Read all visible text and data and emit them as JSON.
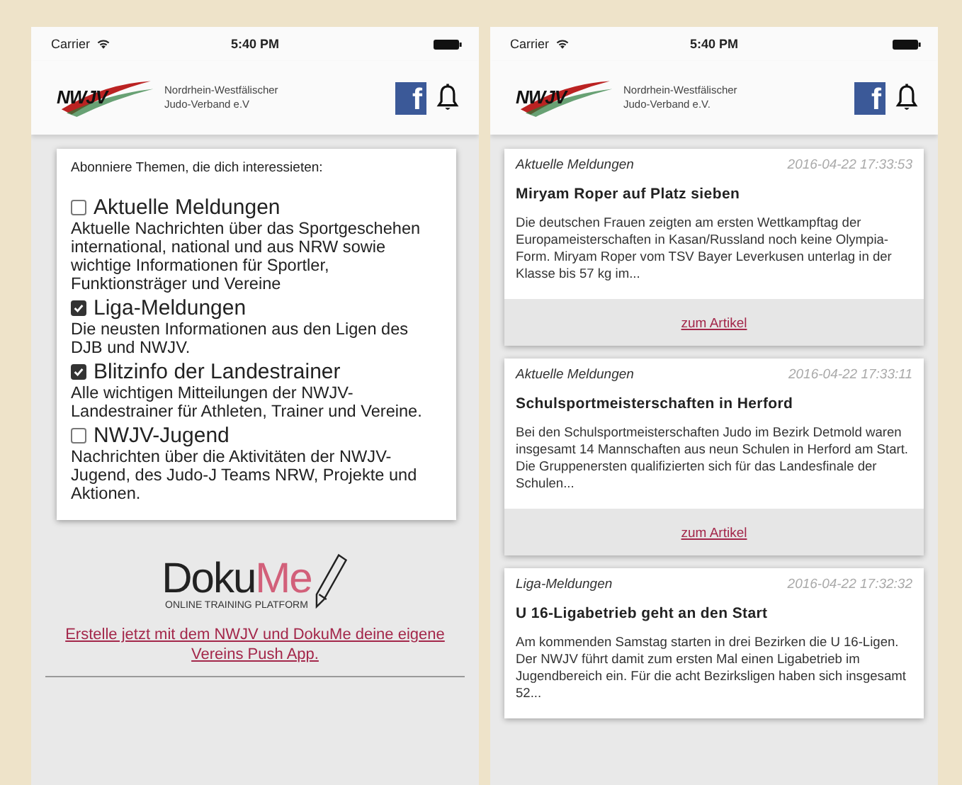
{
  "screens": [
    {
      "status_bar": {
        "carrier": "Carrier",
        "time": "5:40 PM"
      },
      "header": {
        "logo": "NWJV",
        "org_line1": "Nordrhein-Westfälischer",
        "org_line2": "Judo-Verband e.V",
        "facebook": "f"
      },
      "kind": "topics",
      "intro": "Abonniere Themen, die dich interessieten:",
      "topics": [
        {
          "title": "Aktuelle Meldungen",
          "checked": false,
          "description": "Aktuelle Nachrichten über das Sportgeschehen international, national und aus NRW sowie wichtige Informationen für Sportler, Funktionsträger und Vereine"
        },
        {
          "title": "Liga-Meldungen",
          "checked": true,
          "description": "Die neusten Informationen aus den Ligen des DJB und NWJV."
        },
        {
          "title": "Blitzinfo der Landestrainer",
          "checked": true,
          "description": "Alle wichtigen Mitteilungen der NWJV-Landestrainer für Athleten, Trainer und Vereine."
        },
        {
          "title": "NWJV-Jugend",
          "checked": false,
          "description": "Nachrichten über die Aktivitäten der NWJV-Jugend, des Judo-J Teams NRW, Projekte und Aktionen."
        }
      ],
      "promo": {
        "logo_part1": "Doku",
        "logo_part2": "Me",
        "tagline": "ONLINE TRAINING PLATFORM",
        "link": "Erstelle jetzt mit dem NWJV und DokuMe deine eigene Vereins Push App."
      }
    },
    {
      "status_bar": {
        "carrier": "Carrier",
        "time": "5:40 PM"
      },
      "header": {
        "logo": "NWJV",
        "org_line1": "Nordrhein-Westfälischer",
        "org_line2": "Judo-Verband e.V.",
        "facebook": "f"
      },
      "kind": "news",
      "articles": [
        {
          "category": "Aktuelle Meldungen",
          "timestamp": "2016-04-22 17:33:53",
          "title": "Miryam Roper auf Platz sieben",
          "teaser": "Die deutschen Frauen zeigten am ersten Wettkampftag der Europameisterschaften in Kasan/Russland noch keine Olympia-Form. Miryam Roper vom TSV Bayer Leverkusen unterlag in der Klasse bis 57 kg im...",
          "link": "zum Artikel"
        },
        {
          "category": "Aktuelle Meldungen",
          "timestamp": "2016-04-22 17:33:11",
          "title": "Schulsportmeisterschaften in Herford",
          "teaser": "Bei den Schulsportmeisterschaften Judo im Bezirk Detmold waren insgesamt 14 Mannschaften aus neun Schulen in Herford am Start. Die Gruppenersten qualifizierten sich für das Landesfinale der Schulen...",
          "link": "zum Artikel"
        },
        {
          "category": "Liga-Meldungen",
          "timestamp": "2016-04-22 17:32:32",
          "title": "U 16-Ligabetrieb geht an den Start",
          "teaser": "Am kommenden Samstag starten in drei Bezirken die U 16-Ligen. Der NWJV führt damit zum ersten Mal einen Ligabetrieb im Jugendbereich ein. Für die acht Bezirksligen haben sich insgesamt 52..."
        }
      ]
    }
  ]
}
